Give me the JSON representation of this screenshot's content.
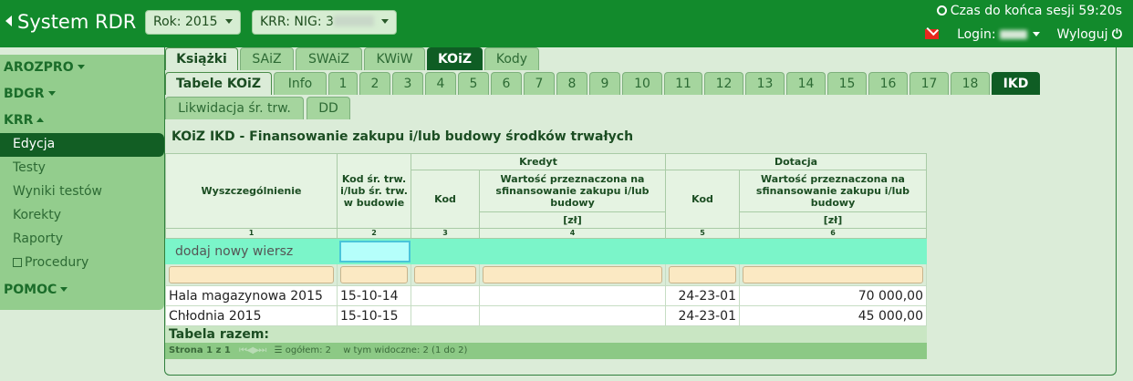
{
  "header": {
    "app_title": "System RDR",
    "year_select": "Rok: 2015",
    "krr_select_prefix": "KRR:  NIG: 3",
    "session_label": "Czas do końca sesji 59:20s",
    "login_label": "Login:",
    "logout_label": "Wyloguj"
  },
  "sidebar": {
    "sections": [
      {
        "label": "AROZPRO"
      },
      {
        "label": "BDGR"
      },
      {
        "label": "KRR"
      },
      {
        "label": "POMOC"
      }
    ],
    "items": [
      {
        "label": "Edycja"
      },
      {
        "label": "Testy"
      },
      {
        "label": "Wyniki testów"
      },
      {
        "label": "Korekty"
      },
      {
        "label": "Raporty"
      },
      {
        "label": "Procedury"
      }
    ]
  },
  "tabs_row1": [
    "Książki",
    "SAiZ",
    "SWAiZ",
    "KWiW",
    "KOiZ",
    "Kody"
  ],
  "tabs_row2": [
    "Tabele KOiZ",
    "Info",
    "1",
    "2",
    "3",
    "4",
    "5",
    "6",
    "7",
    "8",
    "9",
    "10",
    "11",
    "12",
    "13",
    "14",
    "15",
    "16",
    "17",
    "18",
    "IKD"
  ],
  "tabs_row3": [
    "Likwidacja śr. trw.",
    "DD"
  ],
  "page_title": "KOiZ IKD - Finansowanie zakupu i/lub budowy środków trwałych",
  "table": {
    "col_wyszczegolnienie": "Wyszczególnienie",
    "col_kod_st": "Kod śr. trw. i/lub śr. trw. w budowie",
    "group_kredyt": "Kredyt",
    "group_dotacja": "Dotacja",
    "col_kod": "Kod",
    "col_wartosc": "Wartość przeznaczona na sfinansowanie zakupu i/lub budowy",
    "unit": "[zł]",
    "col_numbers": [
      "1",
      "2",
      "3",
      "4",
      "5",
      "6"
    ],
    "add_row_label": "dodaj nowy wiersz",
    "rows": [
      {
        "name": "Hala magazynowa 2015",
        "kod_st": "15-10-14",
        "kredyt_kod": "",
        "kredyt_wartosc": "",
        "dotacja_kod": "24-23-01",
        "dotacja_wartosc": "70 000,00"
      },
      {
        "name": "Chłodnia 2015",
        "kod_st": "15-10-15",
        "kredyt_kod": "",
        "kredyt_wartosc": "",
        "dotacja_kod": "24-23-01",
        "dotacja_wartosc": "45 000,00"
      }
    ],
    "total_label": "Tabela razem:",
    "pager": {
      "page_label": "Strona 1 z 1",
      "total_count": "ogółem: 2",
      "visible_count": "w tym widoczne: 2 (1 do 2)"
    }
  },
  "colors": {
    "topbar": "#128a2c",
    "sidebar": "#93cd8d",
    "active_dark": "#0f5d24",
    "add_row": "#7bf5c9"
  }
}
